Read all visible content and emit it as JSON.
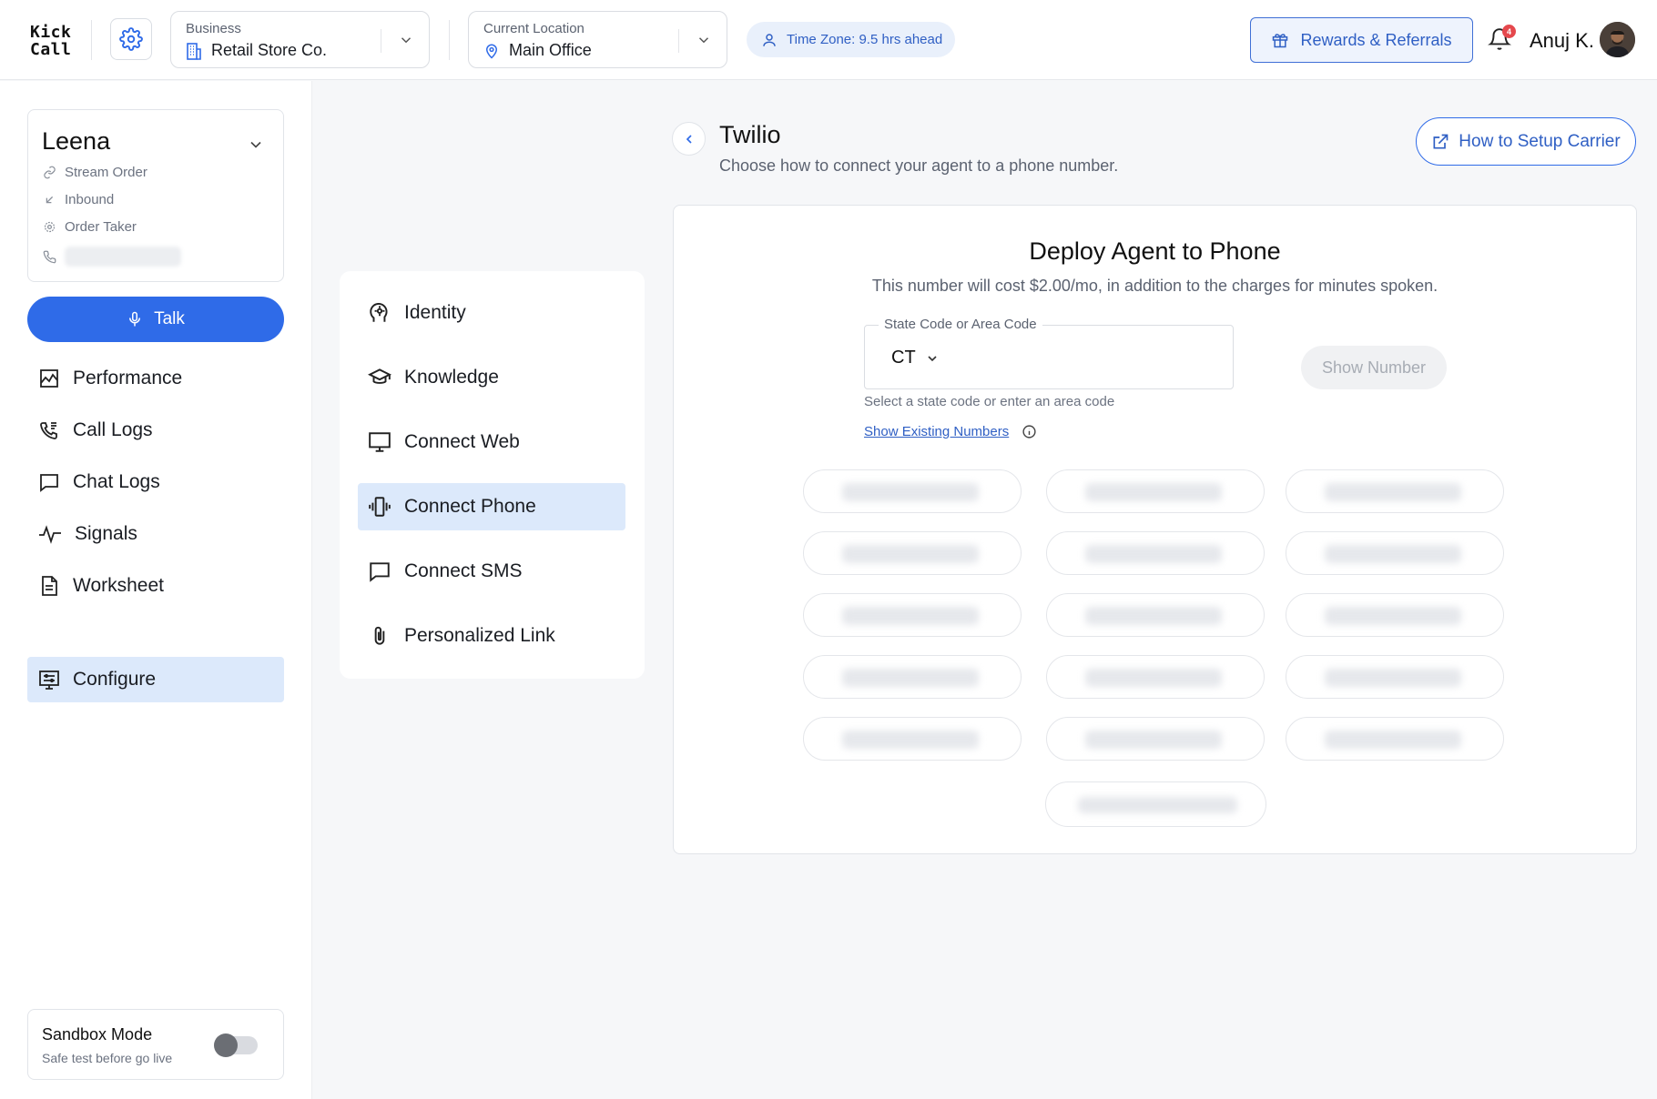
{
  "topbar": {
    "logo_line1": "Kick",
    "logo_line2": "Call",
    "business": {
      "label": "Business",
      "value": "Retail Store Co."
    },
    "location": {
      "label": "Current Location",
      "value": "Main Office"
    },
    "timezone": "Time Zone: 9.5 hrs ahead",
    "rewards_label": "Rewards & Referrals",
    "notification_count": "4",
    "user_name": "Anuj K."
  },
  "agent": {
    "name": "Leena",
    "meta": [
      "Stream Order",
      "Inbound",
      "Order Taker"
    ]
  },
  "talk_label": "Talk",
  "sidebar": {
    "items": [
      {
        "label": "Performance",
        "icon": "chart-icon"
      },
      {
        "label": "Call Logs",
        "icon": "phone-log-icon"
      },
      {
        "label": "Chat Logs",
        "icon": "chat-icon"
      },
      {
        "label": "Signals",
        "icon": "pulse-icon"
      },
      {
        "label": "Worksheet",
        "icon": "document-icon"
      },
      {
        "label": "Configure",
        "icon": "configure-icon",
        "active": true
      }
    ]
  },
  "sandbox": {
    "title": "Sandbox Mode",
    "subtitle": "Safe test before go live",
    "enabled": false
  },
  "config_menu": {
    "items": [
      {
        "label": "Identity",
        "icon": "head-icon"
      },
      {
        "label": "Knowledge",
        "icon": "graduation-cap-icon"
      },
      {
        "label": "Connect Web",
        "icon": "monitor-icon"
      },
      {
        "label": "Connect Phone",
        "icon": "vibrating-phone-icon",
        "active": true
      },
      {
        "label": "Connect SMS",
        "icon": "message-icon"
      },
      {
        "label": "Personalized Link",
        "icon": "paperclip-icon"
      }
    ]
  },
  "page": {
    "title": "Twilio",
    "subtitle": "Choose how to connect your agent to a phone number.",
    "setup_label": "How to Setup Carrier"
  },
  "deploy": {
    "title": "Deploy Agent to Phone",
    "subtitle": "This number will cost $2.00/mo, in addition to the charges for minutes spoken.",
    "state_label": "State Code or Area Code",
    "state_value": "CT",
    "show_number_label": "Show Number",
    "helper": "Select a state code or enter an area code",
    "existing_link": "Show Existing Numbers"
  },
  "colors": {
    "accent": "#2f6be8",
    "active_bg": "#dce9fb",
    "badge": "#e5484d"
  }
}
